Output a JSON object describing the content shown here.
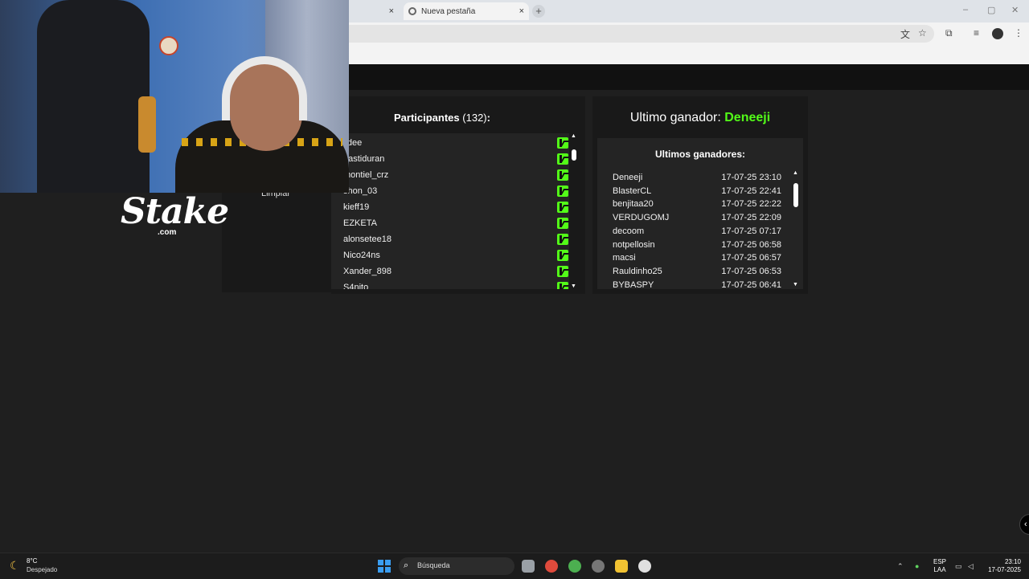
{
  "browser": {
    "tabs": [
      {
        "title": "",
        "close": "×"
      },
      {
        "title": "Nueva pestaña",
        "close": "×"
      }
    ],
    "new_tab": "+",
    "window_controls": [
      "–",
      "▢",
      "✕"
    ]
  },
  "overlay": {
    "logo": "Stake",
    "logo_domain": ".com"
  },
  "left_panel": {
    "clear_button": "Limpiar"
  },
  "participants": {
    "title": "Participantes",
    "count": "(132)",
    "colon": ":",
    "items": [
      "lidee",
      "aastiduran",
      "montiel_crz",
      "shon_03",
      "kieff19",
      "EZKETA",
      "alonsetee18",
      "Nico24ns",
      "Xander_898",
      "S4nito"
    ],
    "platform_icon": "kick-icon",
    "scroll_position": 0.05
  },
  "winners": {
    "last_label": "Ultimo ganador:",
    "last_name": "Deneeji",
    "list_title": "Ultimos ganadores:",
    "items": [
      {
        "name": "Deneeji",
        "time": "17-07-25 23:10"
      },
      {
        "name": "BlasterCL",
        "time": "17-07-25 22:41"
      },
      {
        "name": "benjitaa20",
        "time": "17-07-25 22:22"
      },
      {
        "name": "VERDUGOMJ",
        "time": "17-07-25 22:09"
      },
      {
        "name": "decoom",
        "time": "17-07-25 07:17"
      },
      {
        "name": "notpellosin",
        "time": "17-07-25 06:58"
      },
      {
        "name": "macsi",
        "time": "17-07-25 06:57"
      },
      {
        "name": "Rauldinho25",
        "time": "17-07-25 06:53"
      },
      {
        "name": "BYBASPY",
        "time": "17-07-25 06:41"
      }
    ],
    "scroll_position": 0.05
  },
  "taskbar": {
    "weather_temp": "8°C",
    "weather_desc": "Despejado",
    "search_placeholder": "Búsqueda",
    "lang_top": "ESP",
    "lang_bottom": "LAA",
    "time": "23:10",
    "date": "17-07-2025"
  },
  "colors": {
    "accent_green": "#53fc18",
    "page_bg": "#1f1f1f",
    "panel_bg": "#191919"
  }
}
